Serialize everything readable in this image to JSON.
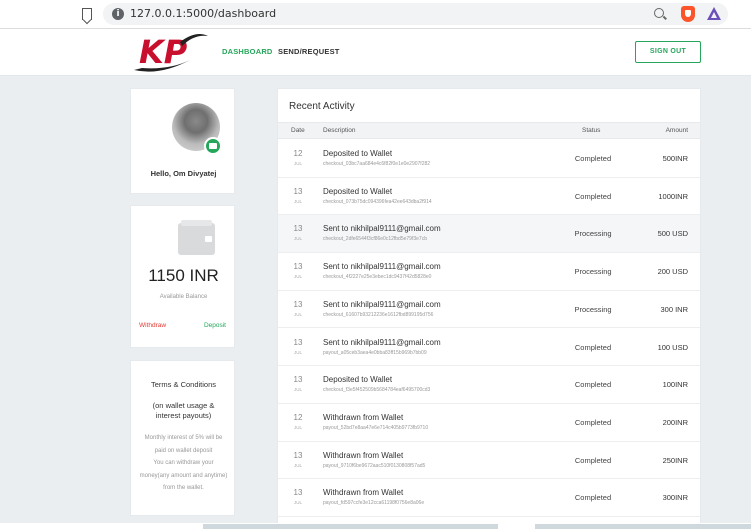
{
  "browser": {
    "url": "127.0.0.1:5000/dashboard",
    "icons": [
      "bookmark-icon",
      "info-icon",
      "zoom-icon",
      "brave-icon",
      "triangle-extension-icon"
    ]
  },
  "header": {
    "logo_text": "KP",
    "nav": {
      "dashboard": "DASHBOARD",
      "send_request": "SEND/REQUEST"
    },
    "sign_out": "SIGN OUT",
    "accent_color": "#26a65b",
    "logo_color": "#c8102e"
  },
  "profile": {
    "greeting": "Hello, Om Divyatej"
  },
  "balance": {
    "amount": "1150 INR",
    "label": "Available Balance",
    "withdraw": "Withdraw",
    "deposit": "Deposit"
  },
  "terms": {
    "title": "Terms & Conditions",
    "subtitle": "(on wallet usage & interest payouts)",
    "line1": "Monthly interest of 5% will be paid on wallet deposit",
    "line2": "You can withdraw your money(any amount and anytime) from the wallet."
  },
  "activity": {
    "title": "Recent Activity",
    "columns": {
      "date": "Date",
      "description": "Description",
      "status": "Status",
      "amount": "Amount"
    },
    "rows": [
      {
        "day": "12",
        "month": "JUL",
        "desc": "Deposited to Wallet",
        "ref": "checkout_03bc7aa684e4c6f82f0e1e0e2907f282",
        "status": "Completed",
        "amount": "500INR"
      },
      {
        "day": "13",
        "month": "JUL",
        "desc": "Deposited to Wallet",
        "ref": "checkout_073b75dc094396fea42ee643dba2f914",
        "status": "Completed",
        "amount": "1000INR"
      },
      {
        "day": "13",
        "month": "JUL",
        "desc": "Sent to nikhilpal9111@gmail.com",
        "ref": "checkout_2dfe6544f3cf86e0c12fbd5e79f3e7cb",
        "status": "Processing",
        "amount": "500 USD"
      },
      {
        "day": "13",
        "month": "JUL",
        "desc": "Sent to nikhilpal9111@gmail.com",
        "ref": "checkout_4f2227e25e3ebec1dc9437f42d5828e0",
        "status": "Processing",
        "amount": "200 USD"
      },
      {
        "day": "13",
        "month": "JUL",
        "desc": "Sent to nikhilpal9111@gmail.com",
        "ref": "checkout_61607b93212236e1612fbd899195d756",
        "status": "Processing",
        "amount": "300 INR"
      },
      {
        "day": "13",
        "month": "JUL",
        "desc": "Sent to nikhilpal9111@gmail.com",
        "ref": "payout_a05ceb3aea4e0bba83ff15b969b7bb09",
        "status": "Completed",
        "amount": "100 USD"
      },
      {
        "day": "13",
        "month": "JUL",
        "desc": "Deposited to Wallet",
        "ref": "checkout_f3e5f452509b5684784eaf6495700cd3",
        "status": "Completed",
        "amount": "100INR"
      },
      {
        "day": "12",
        "month": "JUL",
        "desc": "Withdrawn from Wallet",
        "ref": "payout_52bd7e8aa47e6e714c405b9773fb9710",
        "status": "Completed",
        "amount": "200INR"
      },
      {
        "day": "13",
        "month": "JUL",
        "desc": "Withdrawn from Wallet",
        "ref": "payout_9710f6be9672aac510f0130808f57ad5",
        "status": "Completed",
        "amount": "250INR"
      },
      {
        "day": "13",
        "month": "JUL",
        "desc": "Withdrawn from Wallet",
        "ref": "payout_fd597ccfe3e12cca61198f0756e8a06e",
        "status": "Completed",
        "amount": "300INR"
      }
    ]
  }
}
